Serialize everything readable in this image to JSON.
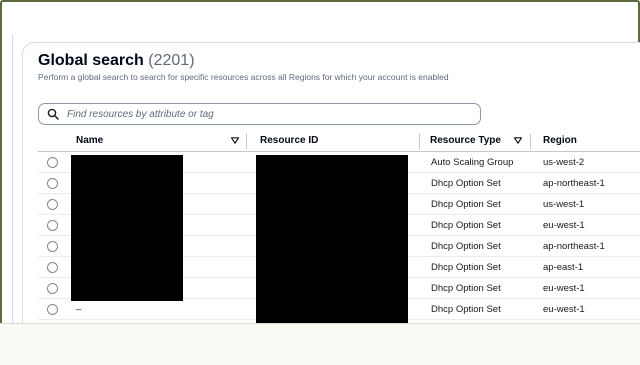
{
  "header": {
    "title": "Global search",
    "count": "(2201)",
    "subtitle": "Perform a global search to search for specific resources across all Regions for which your account is enabled"
  },
  "search": {
    "placeholder": "Find resources by attribute or tag",
    "icon": "search-icon"
  },
  "table": {
    "columns": [
      "Name",
      "Resource ID",
      "Resource Type",
      "Region"
    ],
    "rows": [
      {
        "name": "",
        "resource_id": "",
        "type": "Auto Scaling Group",
        "region": "us-west-2"
      },
      {
        "name": "",
        "resource_id": "",
        "type": "Dhcp Option Set",
        "region": "ap-northeast-1"
      },
      {
        "name": "",
        "resource_id": "",
        "type": "Dhcp Option Set",
        "region": "us-west-1"
      },
      {
        "name": "",
        "resource_id": "",
        "type": "Dhcp Option Set",
        "region": "eu-west-1"
      },
      {
        "name": "",
        "resource_id": "",
        "type": "Dhcp Option Set",
        "region": "ap-northeast-1"
      },
      {
        "name": "",
        "resource_id": "",
        "type": "Dhcp Option Set",
        "region": "ap-east-1"
      },
      {
        "name": "",
        "resource_id": "",
        "type": "Dhcp Option Set",
        "region": "eu-west-1"
      },
      {
        "name": "–",
        "resource_id": "",
        "type": "Dhcp Option Set",
        "region": "eu-west-1"
      }
    ]
  },
  "colors": {
    "frame": "#5b6b3a",
    "border": "#d5dbdb",
    "text": "#16191f",
    "muted": "#5f6b7a"
  }
}
